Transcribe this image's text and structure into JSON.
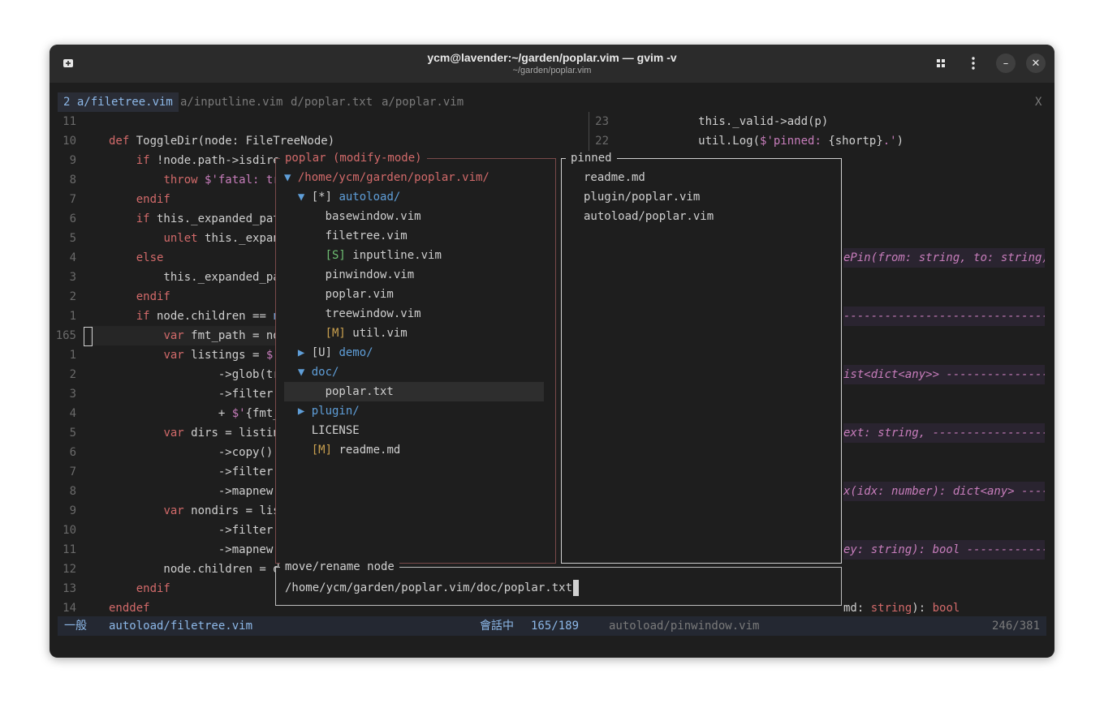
{
  "window": {
    "title": "ycm@lavender:~/garden/poplar.vim — gvim -v",
    "subtitle": "~/garden/poplar.vim",
    "new_tab_icon": "new-tab-icon",
    "grid_icon": "grid-icon",
    "menu_icon": "kebab-menu-icon",
    "minimize": "–",
    "close": "✕"
  },
  "tabs": [
    {
      "label": "2 a/filetree.vim"
    },
    {
      "label": "a/inputline.vim"
    },
    {
      "label": "d/poplar.txt"
    },
    {
      "label": "a/poplar.vim"
    }
  ],
  "tab_close": "X",
  "editor_left": [
    {
      "n": "11",
      "segs": []
    },
    {
      "n": "10",
      "segs": [
        {
          "t": "def ",
          "c": "kw"
        },
        {
          "t": "ToggleDir(node: FileTreeNode)",
          "c": "fn"
        }
      ]
    },
    {
      "n": "9",
      "segs": [
        {
          "t": "    ",
          "c": "fn"
        },
        {
          "t": "if",
          "c": "kw"
        },
        {
          "t": " !node.path->isdire",
          "c": "fn"
        }
      ]
    },
    {
      "n": "8",
      "segs": [
        {
          "t": "        ",
          "c": "fn"
        },
        {
          "t": "throw",
          "c": "kw"
        },
        {
          "t": " $'fatal: tr",
          "c": "str"
        }
      ]
    },
    {
      "n": "7",
      "segs": [
        {
          "t": "    ",
          "c": "fn"
        },
        {
          "t": "endif",
          "c": "kw"
        }
      ]
    },
    {
      "n": "6",
      "segs": [
        {
          "t": "    ",
          "c": "fn"
        },
        {
          "t": "if",
          "c": "kw"
        },
        {
          "t": " this._expanded_pat",
          "c": "fn"
        }
      ]
    },
    {
      "n": "5",
      "segs": [
        {
          "t": "        ",
          "c": "fn"
        },
        {
          "t": "unlet",
          "c": "kw"
        },
        {
          "t": " this._expan",
          "c": "fn"
        }
      ]
    },
    {
      "n": "4",
      "segs": [
        {
          "t": "    ",
          "c": "fn"
        },
        {
          "t": "else",
          "c": "kw"
        }
      ]
    },
    {
      "n": "3",
      "segs": [
        {
          "t": "        this._expanded_pa",
          "c": "fn"
        }
      ]
    },
    {
      "n": "2",
      "segs": [
        {
          "t": "    ",
          "c": "fn"
        },
        {
          "t": "endif",
          "c": "kw"
        }
      ]
    },
    {
      "n": "1",
      "segs": [
        {
          "t": "    ",
          "c": "fn"
        },
        {
          "t": "if",
          "c": "kw"
        },
        {
          "t": " node.children == ",
          "c": "fn"
        },
        {
          "t": "n",
          "c": "typ"
        }
      ]
    },
    {
      "n": "165",
      "segs": [
        {
          "t": "        ",
          "c": "fn"
        },
        {
          "t": "var",
          "c": "kw"
        },
        {
          "t": " fmt_path = no",
          "c": "fn"
        }
      ],
      "current": true
    },
    {
      "n": "1",
      "segs": [
        {
          "t": "        ",
          "c": "fn"
        },
        {
          "t": "var",
          "c": "kw"
        },
        {
          "t": " listings = ",
          "c": "fn"
        },
        {
          "t": "$'",
          "c": "str"
        }
      ]
    },
    {
      "n": "2",
      "segs": [
        {
          "t": "                ->glob(tr",
          "c": "fn"
        }
      ]
    },
    {
      "n": "3",
      "segs": [
        {
          "t": "                ->filter(",
          "c": "fn"
        }
      ]
    },
    {
      "n": "4",
      "segs": [
        {
          "t": "                + ",
          "c": "fn"
        },
        {
          "t": "$'",
          "c": "str"
        },
        {
          "t": "{fmt_",
          "c": "fn"
        }
      ]
    },
    {
      "n": "5",
      "segs": [
        {
          "t": "        ",
          "c": "fn"
        },
        {
          "t": "var",
          "c": "kw"
        },
        {
          "t": " dirs = listin",
          "c": "fn"
        }
      ]
    },
    {
      "n": "6",
      "segs": [
        {
          "t": "                ->copy()",
          "c": "fn"
        }
      ]
    },
    {
      "n": "7",
      "segs": [
        {
          "t": "                ->filter(",
          "c": "fn"
        }
      ]
    },
    {
      "n": "8",
      "segs": [
        {
          "t": "                ->mapnew(",
          "c": "fn"
        }
      ]
    },
    {
      "n": "9",
      "segs": [
        {
          "t": "        ",
          "c": "fn"
        },
        {
          "t": "var",
          "c": "kw"
        },
        {
          "t": " nondirs = lis",
          "c": "fn"
        }
      ]
    },
    {
      "n": "10",
      "segs": [
        {
          "t": "                ->filter(",
          "c": "fn"
        }
      ]
    },
    {
      "n": "11",
      "segs": [
        {
          "t": "                ->mapnew(",
          "c": "fn"
        }
      ]
    },
    {
      "n": "12",
      "segs": [
        {
          "t": "        node.children = d",
          "c": "fn"
        }
      ]
    },
    {
      "n": "13",
      "segs": [
        {
          "t": "    ",
          "c": "fn"
        },
        {
          "t": "endif",
          "c": "kw"
        }
      ]
    },
    {
      "n": "14",
      "segs": [
        {
          "t": "enddef",
          "c": "kw"
        }
      ]
    }
  ],
  "editor_right": [
    {
      "n": "23",
      "segs": [
        {
          "t": "            this._valid->add(p)",
          "c": "fn"
        }
      ]
    },
    {
      "n": "22",
      "segs": [
        {
          "t": "            util.Log(",
          "c": "fn"
        },
        {
          "t": "$'pinned: ",
          "c": "str"
        },
        {
          "t": "{shortp}",
          "c": "fn"
        },
        {
          "t": ".'",
          "c": "str"
        },
        {
          "t": ")",
          "c": "fn"
        }
      ]
    }
  ],
  "ghost_lines": [
    {
      "row": 7,
      "text": "ePin(from: string, to: string) "
    },
    {
      "row": 10,
      "text": "-------------------------------"
    },
    {
      "row": 13,
      "text": "ist<dict<any>> ----------------"
    },
    {
      "row": 16,
      "text": "ext: string, ------------------"
    },
    {
      "row": 19,
      "text": "x(idx: number): dict<any> -----"
    },
    {
      "row": 22,
      "text": "ey: string): bool -------------"
    }
  ],
  "right_tail": {
    "a": "md: ",
    "b": "string",
    "c": "): ",
    "d": "bool"
  },
  "tree_popup": {
    "title": "poplar (modify-mode)",
    "rows": [
      {
        "arrow": "▼ ",
        "flag": "",
        "flagc": "",
        "name": "/home/ycm/garden/poplar.vim/",
        "namec": "kw",
        "indent": ""
      },
      {
        "arrow": "▼ ",
        "flag": "[*] ",
        "flagc": "fn",
        "name": "autoload/",
        "namec": "dir",
        "indent": "  "
      },
      {
        "arrow": "",
        "flag": "",
        "flagc": "",
        "name": "basewindow.vim",
        "namec": "fn",
        "indent": "      "
      },
      {
        "arrow": "",
        "flag": "",
        "flagc": "",
        "name": "filetree.vim",
        "namec": "fn",
        "indent": "      "
      },
      {
        "arrow": "",
        "flag": "[S] ",
        "flagc": "flag-s",
        "name": "inputline.vim",
        "namec": "fn",
        "indent": "      "
      },
      {
        "arrow": "",
        "flag": "",
        "flagc": "",
        "name": "pinwindow.vim",
        "namec": "fn",
        "indent": "      "
      },
      {
        "arrow": "",
        "flag": "",
        "flagc": "",
        "name": "poplar.vim",
        "namec": "fn",
        "indent": "      "
      },
      {
        "arrow": "",
        "flag": "",
        "flagc": "",
        "name": "treewindow.vim",
        "namec": "fn",
        "indent": "      "
      },
      {
        "arrow": "",
        "flag": "[M] ",
        "flagc": "flag-m",
        "name": "util.vim",
        "namec": "fn",
        "indent": "      "
      },
      {
        "arrow": "▶ ",
        "flag": "[U] ",
        "flagc": "fn",
        "name": "demo/",
        "namec": "dir",
        "indent": "  "
      },
      {
        "arrow": "▼ ",
        "flag": "",
        "flagc": "",
        "name": "doc/",
        "namec": "dir",
        "indent": "  "
      },
      {
        "arrow": "",
        "flag": "",
        "flagc": "",
        "name": "poplar.txt",
        "namec": "fn",
        "indent": "      ",
        "selected": true
      },
      {
        "arrow": "▶ ",
        "flag": "",
        "flagc": "",
        "name": "plugin/",
        "namec": "dir",
        "indent": "  "
      },
      {
        "arrow": "",
        "flag": "",
        "flagc": "",
        "name": "LICENSE",
        "namec": "fn",
        "indent": "    "
      },
      {
        "arrow": "",
        "flag": "[M] ",
        "flagc": "flag-m",
        "name": "readme.md",
        "namec": "fn",
        "indent": "    "
      }
    ]
  },
  "pinned_popup": {
    "title": "pinned",
    "items": [
      "readme.md",
      "plugin/poplar.vim",
      "autoload/poplar.vim"
    ]
  },
  "input_popup": {
    "title": "move/rename node",
    "value": "/home/ycm/garden/poplar.vim/doc/poplar.txt"
  },
  "statusline": {
    "mode": "一般",
    "left_file": "autoload/filetree.vim",
    "state": "會話中",
    "left_pos": "165/189",
    "right_file": "autoload/pinwindow.vim",
    "right_pos": "246/381"
  }
}
